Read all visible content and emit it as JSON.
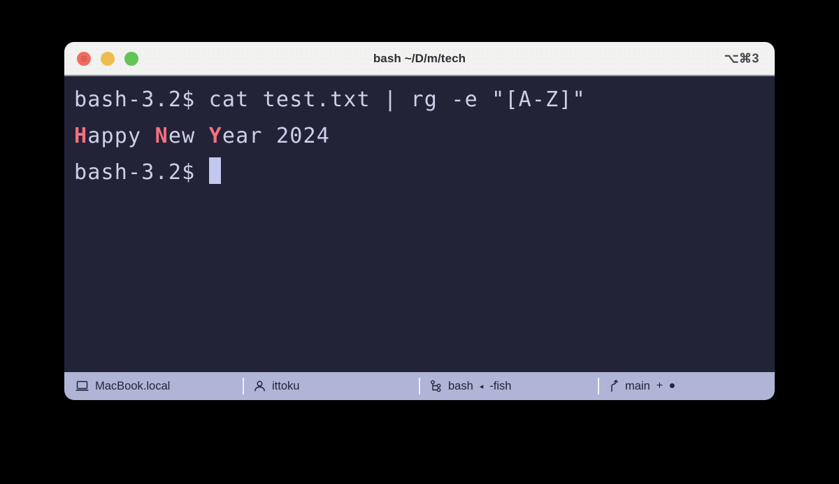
{
  "window": {
    "title": "bash ~/D/m/tech",
    "shortcut": "⌥⌘3",
    "controls": {
      "close_label": "close",
      "minimize_label": "minimize",
      "maximize_label": "maximize"
    }
  },
  "terminal": {
    "prompt": "bash-3.2$ ",
    "command": "cat test.txt | rg -e \"[A-Z]\"",
    "output": {
      "segments": [
        {
          "text": "H",
          "highlight": true
        },
        {
          "text": "appy ",
          "highlight": false
        },
        {
          "text": "N",
          "highlight": true
        },
        {
          "text": "ew ",
          "highlight": false
        },
        {
          "text": "Y",
          "highlight": true
        },
        {
          "text": "ear 2024",
          "highlight": false
        }
      ],
      "plain": "Happy New Year 2024"
    },
    "prompt2": "bash-3.2$ ",
    "colors": {
      "background": "#232338",
      "foreground": "#ccd0e8",
      "match": "#f4707e",
      "cursor": "#c3c8ee"
    }
  },
  "statusbar": {
    "background": "#b0b4d6",
    "items": [
      {
        "icon": "laptop-icon",
        "label": "MacBook.local"
      },
      {
        "icon": "person-icon",
        "label": "ittoku"
      },
      {
        "icon": "process-tree-icon",
        "label": "bash",
        "arrow": "◂",
        "sublabel": "-fish"
      },
      {
        "icon": "git-branch-icon",
        "label": "main",
        "marks": "+ ●"
      }
    ]
  }
}
